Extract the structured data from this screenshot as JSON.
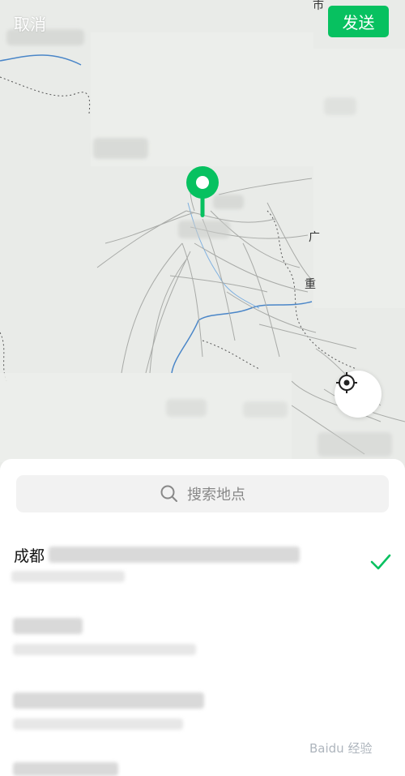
{
  "topbar": {
    "cancel_label": "取消",
    "send_label": "发送"
  },
  "map": {
    "labels": {
      "city_top_right": "市",
      "label_guang": "广",
      "label_chong": "重"
    },
    "pin_color": "#07c160"
  },
  "search": {
    "placeholder": "搜索地点"
  },
  "results": [
    {
      "title": "成都",
      "selected": true
    }
  ],
  "colors": {
    "accent": "#07c160",
    "search_bg": "#f2f2f2"
  },
  "watermark": "Baidu 经验"
}
